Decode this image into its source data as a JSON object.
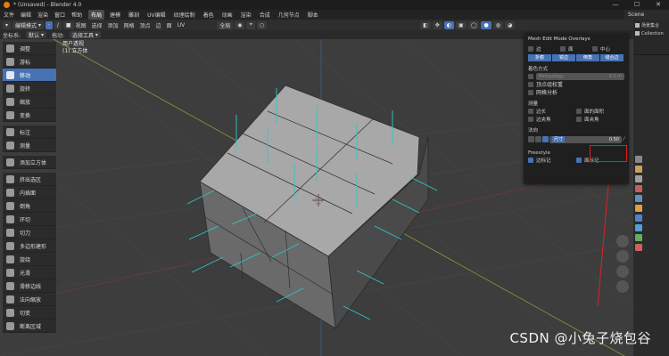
{
  "window": {
    "title": "* (Unsaved) - Blender 4.0",
    "controls": [
      "—",
      "☐",
      "✕"
    ]
  },
  "menu": {
    "items": [
      "文件",
      "编辑",
      "渲染",
      "窗口",
      "帮助"
    ],
    "workspaces": [
      "布局",
      "建模",
      "雕刻",
      "UV编辑",
      "纹理绘制",
      "着色",
      "动画",
      "渲染",
      "合成",
      "几何节点",
      "脚本"
    ],
    "active_workspace": "布局",
    "scene": "Scene"
  },
  "header": {
    "mode": "编辑模式",
    "menus": [
      "视图",
      "选择",
      "添加",
      "网格",
      "顶点",
      "边",
      "面",
      "UV"
    ],
    "transform_orientation": "全局"
  },
  "toolsettings": {
    "orientation_label": "坐标系:",
    "orientation_value": "默认",
    "drag_label": "拖动:",
    "drag_value": "选择工具"
  },
  "viewport": {
    "view_name": "用户透视",
    "object_name": "(1) 立方体"
  },
  "tools": [
    {
      "label": "调整",
      "icon": "tweak-icon",
      "active": false
    },
    {
      "label": "游标",
      "icon": "cursor-icon",
      "active": false
    },
    {
      "label": "移动",
      "icon": "move-icon",
      "active": true
    },
    {
      "label": "旋转",
      "icon": "rotate-icon",
      "active": false
    },
    {
      "label": "缩放",
      "icon": "scale-icon",
      "active": false
    },
    {
      "label": "变换",
      "icon": "transform-icon",
      "active": false
    },
    {
      "label": "标注",
      "icon": "annotate-icon",
      "active": false,
      "gap": true
    },
    {
      "label": "测量",
      "icon": "measure-icon",
      "active": false
    },
    {
      "label": "添加立方体",
      "icon": "add-cube-icon",
      "active": false,
      "gap": true
    },
    {
      "label": "挤出选区",
      "icon": "extrude-icon",
      "active": false,
      "gap": true
    },
    {
      "label": "内插面",
      "icon": "inset-icon",
      "active": false
    },
    {
      "label": "倒角",
      "icon": "bevel-icon",
      "active": false
    },
    {
      "label": "环切",
      "icon": "loopcut-icon",
      "active": false
    },
    {
      "label": "切刀",
      "icon": "knife-icon",
      "active": false
    },
    {
      "label": "多边形建形",
      "icon": "polybuild-icon",
      "active": false
    },
    {
      "label": "旋绕",
      "icon": "spin-icon",
      "active": false
    },
    {
      "label": "光滑",
      "icon": "smooth-icon",
      "active": false
    },
    {
      "label": "滑移边线",
      "icon": "edge-slide-icon",
      "active": false
    },
    {
      "label": "法向缩放",
      "icon": "shrink-fatten-icon",
      "active": false
    },
    {
      "label": "切变",
      "icon": "shear-icon",
      "active": false
    },
    {
      "label": "断离区域",
      "icon": "rip-region-icon",
      "active": false
    }
  ],
  "overlays": {
    "title": "Mesh Edit Mode Overlays",
    "row1": [
      {
        "label": "边",
        "on": false
      },
      {
        "label": "面",
        "on": false
      },
      {
        "label": "中心",
        "on": false
      }
    ],
    "seg1": [
      "折痕",
      "锐边",
      "倒角",
      "缝合边"
    ],
    "shading_title": "着色方式",
    "retopology": "Retopology",
    "retopology_value": "0.2 m",
    "vertex_groups": "顶点组权重",
    "mesh_analysis": "网格分析",
    "measure_title": "测量",
    "measure": [
      {
        "label": "边长",
        "on": false
      },
      {
        "label": "面的面积",
        "on": false
      },
      {
        "label": "边夹角",
        "on": false
      },
      {
        "label": "面夹角",
        "on": false
      }
    ],
    "normals_title": "法向",
    "normals_label": "尺寸",
    "normals_value": "0.50",
    "freestyle_title": "Freestyle",
    "freestyle": [
      {
        "label": "边标记",
        "on": true
      },
      {
        "label": "面标记",
        "on": true
      }
    ]
  },
  "outliner": {
    "items": [
      "场景集合",
      "Collection"
    ]
  },
  "watermark": "CSDN @小兔子烧包谷",
  "colors": {
    "accent": "#4772b3",
    "highlight": "#e02020",
    "normals": "#2ec8c8"
  }
}
